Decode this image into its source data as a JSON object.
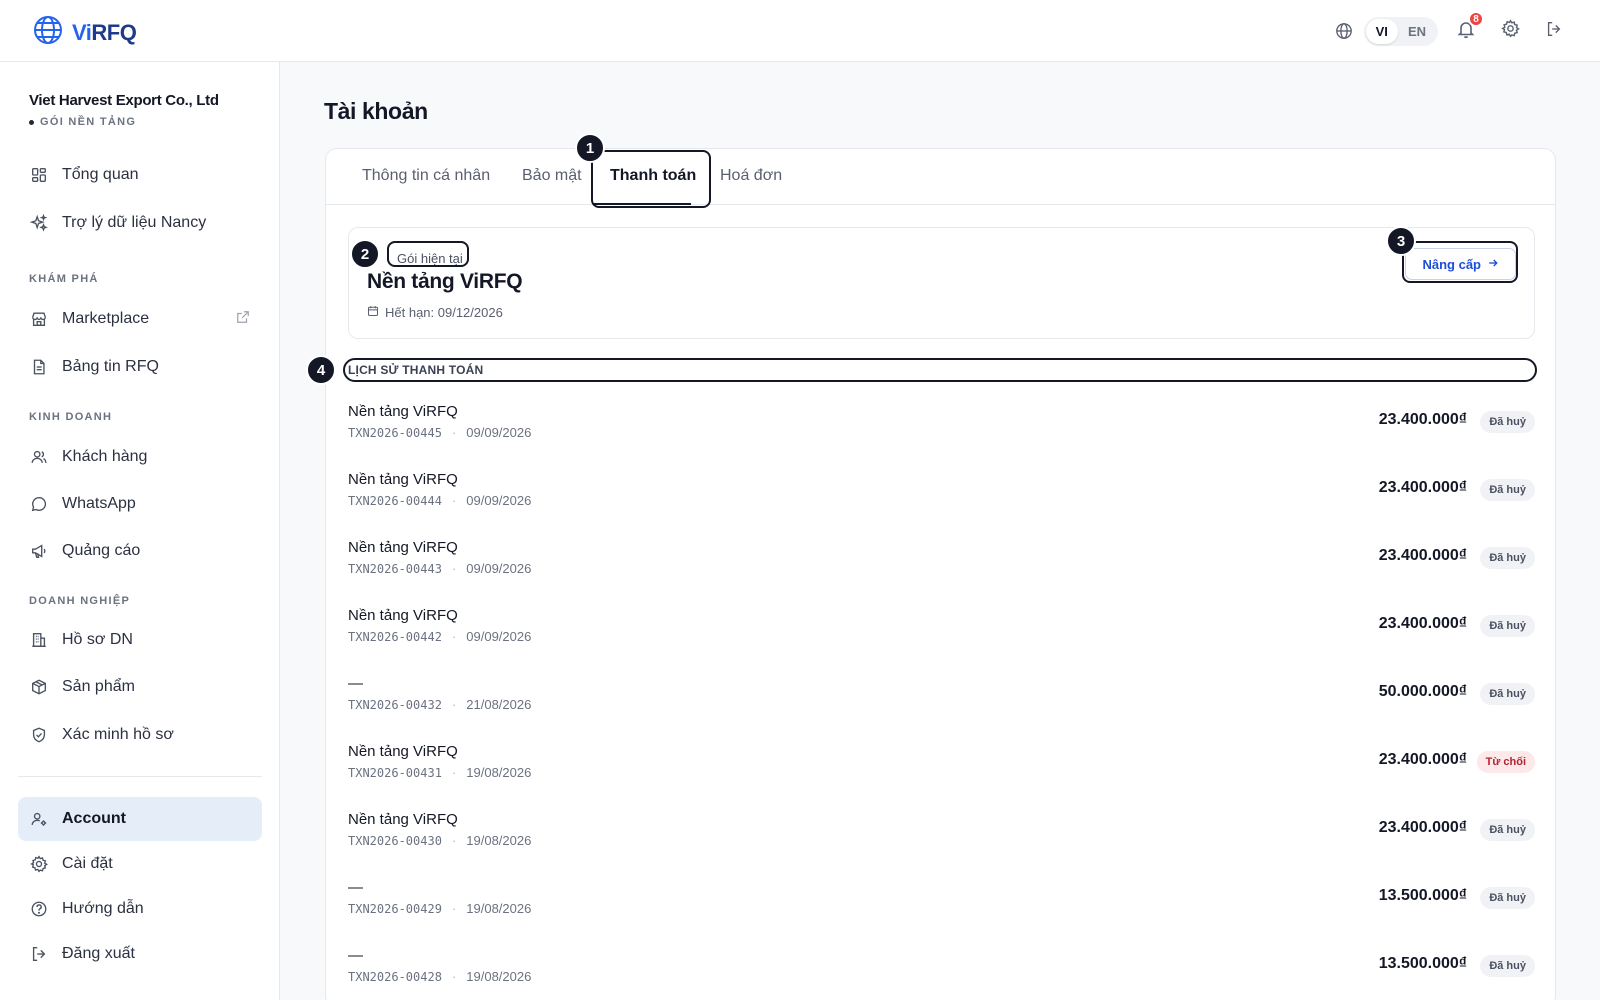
{
  "brand": {
    "logo_vi": "Vi",
    "logo_rfq": "RFQ"
  },
  "header": {
    "languages": [
      "VI",
      "EN"
    ],
    "active_language": "VI",
    "notification_count": "8"
  },
  "sidebar": {
    "company_name": "Viet Harvest Export Co., Ltd",
    "company_plan": "GÓI NỀN TẢNG",
    "sections": {
      "explore": "KHÁM PHÁ",
      "business": "KINH DOANH",
      "enterprise": "DOANH NGHIỆP"
    },
    "items": {
      "overview": "Tổng quan",
      "nancy": "Trợ lý dữ liệu Nancy",
      "marketplace": "Marketplace",
      "rfq_board": "Bảng tin RFQ",
      "customers": "Khách hàng",
      "whatsapp": "WhatsApp",
      "ads": "Quảng cáo",
      "company_profile": "Hồ sơ DN",
      "products": "Sản phẩm",
      "verify": "Xác minh hồ sơ",
      "account": "Account",
      "settings": "Cài đặt",
      "guide": "Hướng dẫn",
      "logout": "Đăng xuất"
    }
  },
  "main": {
    "title": "Tài khoản",
    "tabs": [
      "Thông tin cá nhân",
      "Bảo mật",
      "Thanh toán",
      "Hoá đơn"
    ],
    "active_tab": "Thanh toán",
    "plan": {
      "label": "Gói hiện tại",
      "name": "Nền tảng ViRFQ",
      "expiry": "Hết hạn: 09/12/2026",
      "upgrade_label": "Nâng cấp"
    },
    "history_label": "LỊCH SỬ THANH TOÁN",
    "transactions": [
      {
        "title": "Nền tảng ViRFQ",
        "id": "TXN2026-00445",
        "date": "09/09/2026",
        "amount": "23.400.000₫",
        "status": "Đã huỷ"
      },
      {
        "title": "Nền tảng ViRFQ",
        "id": "TXN2026-00444",
        "date": "09/09/2026",
        "amount": "23.400.000₫",
        "status": "Đã huỷ"
      },
      {
        "title": "Nền tảng ViRFQ",
        "id": "TXN2026-00443",
        "date": "09/09/2026",
        "amount": "23.400.000₫",
        "status": "Đã huỷ"
      },
      {
        "title": "Nền tảng ViRFQ",
        "id": "TXN2026-00442",
        "date": "09/09/2026",
        "amount": "23.400.000₫",
        "status": "Đã huỷ"
      },
      {
        "title": "—",
        "id": "TXN2026-00432",
        "date": "21/08/2026",
        "amount": "50.000.000₫",
        "status": "Đã huỷ"
      },
      {
        "title": "Nền tảng ViRFQ",
        "id": "TXN2026-00431",
        "date": "19/08/2026",
        "amount": "23.400.000₫",
        "status": "Từ chối"
      },
      {
        "title": "Nền tảng ViRFQ",
        "id": "TXN2026-00430",
        "date": "19/08/2026",
        "amount": "23.400.000₫",
        "status": "Đã huỷ"
      },
      {
        "title": "—",
        "id": "TXN2026-00429",
        "date": "19/08/2026",
        "amount": "13.500.000₫",
        "status": "Đã huỷ"
      },
      {
        "title": "—",
        "id": "TXN2026-00428",
        "date": "19/08/2026",
        "amount": "13.500.000₫",
        "status": "Đã huỷ"
      }
    ]
  },
  "annotations": [
    "1",
    "2",
    "3",
    "4"
  ],
  "colors": {
    "accent": "#2563eb",
    "active_nav": "#e5edf9",
    "rejected": "#b4232f"
  }
}
